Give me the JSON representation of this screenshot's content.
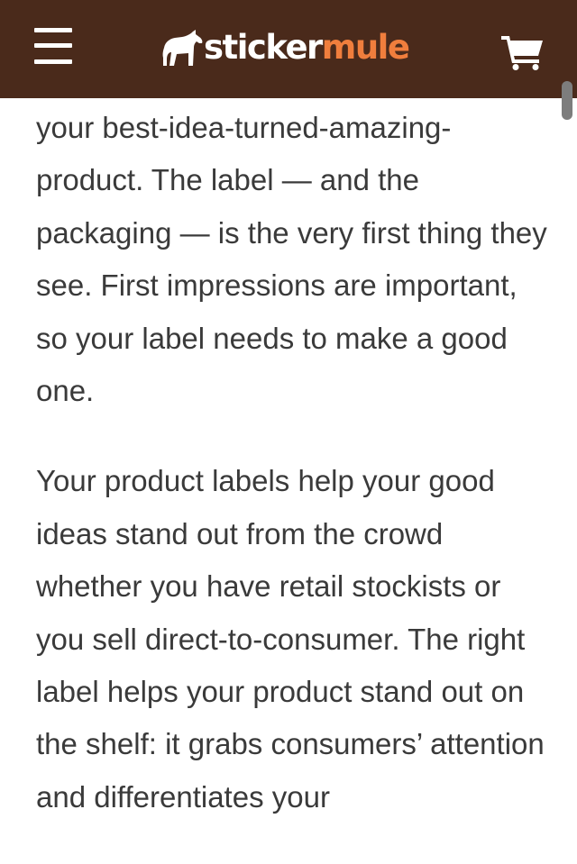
{
  "header": {
    "brand": {
      "sticker": "sticker",
      "mule": "mule"
    },
    "icons": {
      "menu": "hamburger-menu-icon",
      "logo": "mule-logo-icon",
      "cart": "shopping-cart-icon"
    },
    "colors": {
      "background": "#4a2a1b",
      "brand_accent": "#f07e3d",
      "text": "#ffffff"
    }
  },
  "article": {
    "paragraphs": [
      "your best-idea-turned-amazing-product. The label — and the packaging — is the very first thing they see. First impressions are important, so your label needs to make a good one.",
      "Your product labels help your good ideas stand out from the crowd whether you have retail stockists or you sell direct-to-consumer. The right label helps your product stand out on the shelf: it grabs consumers’ attention and differentiates your"
    ]
  }
}
